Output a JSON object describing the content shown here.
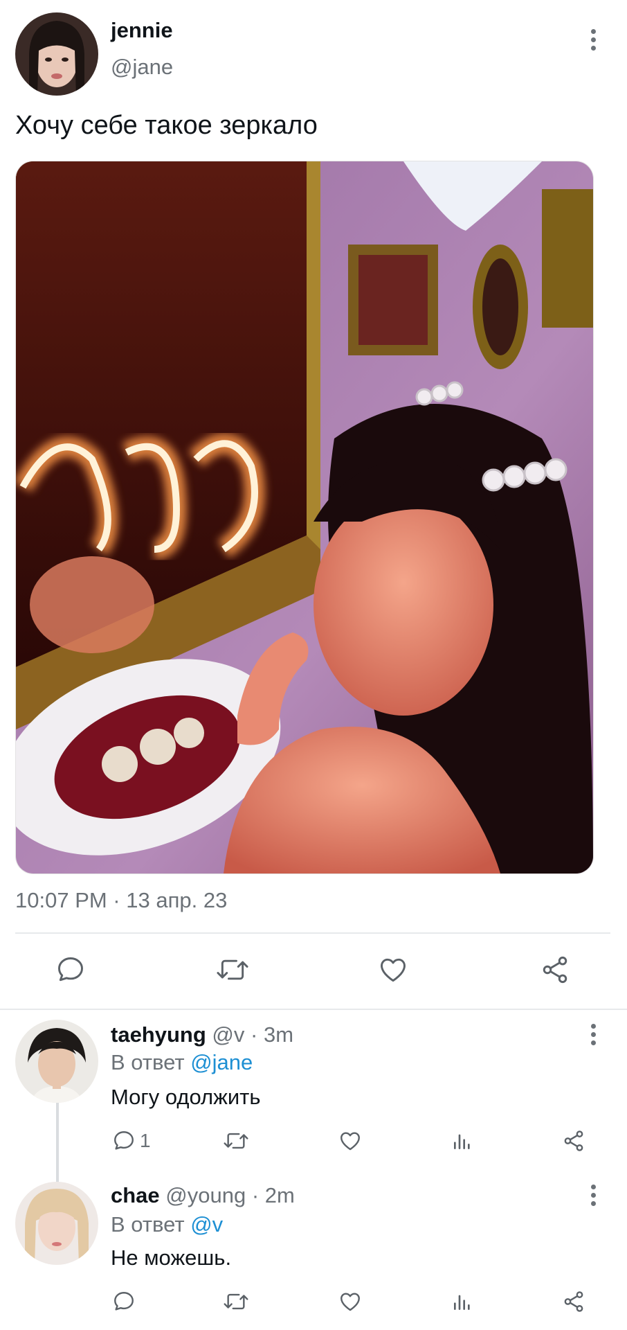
{
  "main_tweet": {
    "author_name": "jennie",
    "author_handle": "@jane",
    "text": "Хочу себе такое зеркало",
    "photo_neon_text": "nge",
    "timestamp": "10:07 PM · 13 апр. 23",
    "actions": [
      "reply-icon",
      "retweet-icon",
      "like-icon",
      "share-icon"
    ]
  },
  "replies": [
    {
      "author_name": "taehyung",
      "author_handle": "@v",
      "time": "· 3m",
      "reply_prefix": "В ответ",
      "reply_to": "@jane",
      "text": "Могу одолжить",
      "reply_count": "1"
    },
    {
      "author_name": "chae",
      "author_handle": "@young",
      "time": "· 2m",
      "reply_prefix": "В ответ",
      "reply_to": "@v",
      "text": "Не можешь.",
      "reply_count": ""
    }
  ],
  "colors": {
    "link": "#1d8fd3",
    "muted": "#6b7177",
    "icon": "#5b6167",
    "divider": "#e7e9eb"
  }
}
